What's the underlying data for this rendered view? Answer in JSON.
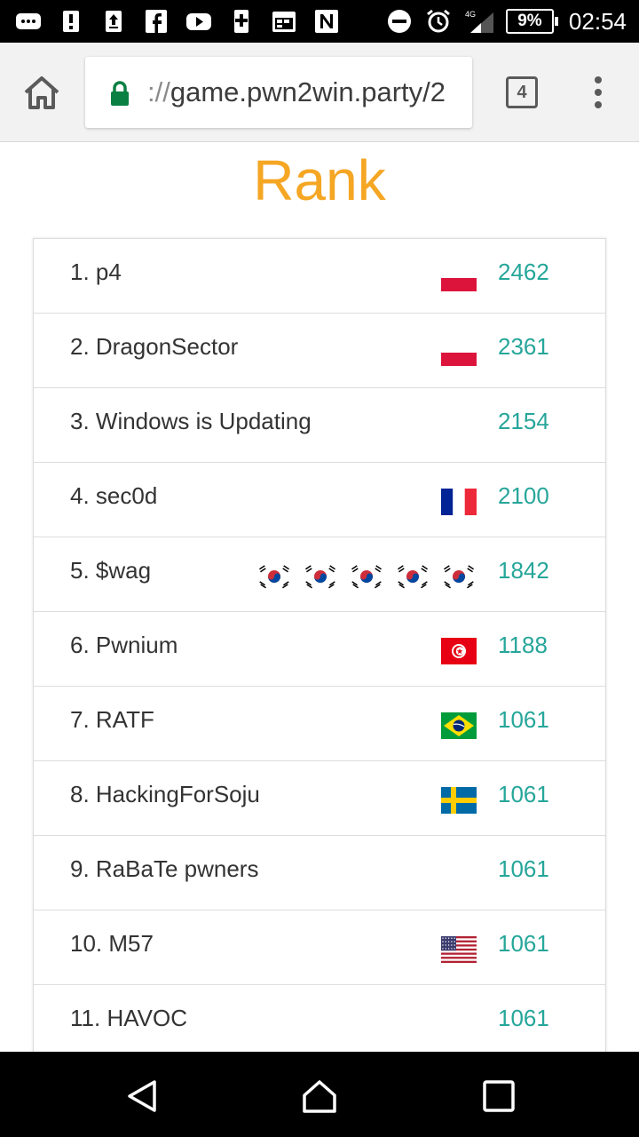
{
  "status_bar": {
    "time": "02:54",
    "battery": "9%",
    "network": "4G",
    "left_icons": [
      "chat-icon",
      "alert-icon",
      "upload-icon",
      "facebook-icon",
      "youtube-icon",
      "download-icon",
      "calendar-icon",
      "nfc-icon"
    ],
    "right_icons": [
      "do-not-disturb-icon",
      "alarm-icon",
      "signal-icon",
      "battery-icon"
    ]
  },
  "browser": {
    "url_scheme": "://",
    "url_text": "game.pwn2win.party/2",
    "tab_count": "4"
  },
  "page": {
    "title": "Rank",
    "title_color": "#f5a623",
    "score_color": "#26a69a"
  },
  "ranking": [
    {
      "rank_name": "1. p4",
      "score": "2462",
      "flags": [
        "poland"
      ]
    },
    {
      "rank_name": "2. DragonSector",
      "score": "2361",
      "flags": [
        "poland"
      ]
    },
    {
      "rank_name": "3. Windows is Updating",
      "score": "2154",
      "flags": []
    },
    {
      "rank_name": "4. sec0d",
      "score": "2100",
      "flags": [
        "france"
      ]
    },
    {
      "rank_name": "5. $wag",
      "score": "1842",
      "flags": [
        "south-korea",
        "south-korea",
        "south-korea",
        "south-korea",
        "south-korea"
      ]
    },
    {
      "rank_name": "6. Pwnium",
      "score": "1188",
      "flags": [
        "tunisia"
      ]
    },
    {
      "rank_name": "7. RATF",
      "score": "1061",
      "flags": [
        "brazil"
      ]
    },
    {
      "rank_name": "8. HackingForSoju",
      "score": "1061",
      "flags": [
        "sweden"
      ]
    },
    {
      "rank_name": "9. RaBaTe pwners",
      "score": "1061",
      "flags": []
    },
    {
      "rank_name": "10. M57",
      "score": "1061",
      "flags": [
        "usa"
      ]
    },
    {
      "rank_name": "11. HAVOC",
      "score": "1061",
      "flags": []
    }
  ],
  "nav_bar": {
    "buttons": [
      "back-icon",
      "home-icon",
      "recents-icon"
    ]
  }
}
